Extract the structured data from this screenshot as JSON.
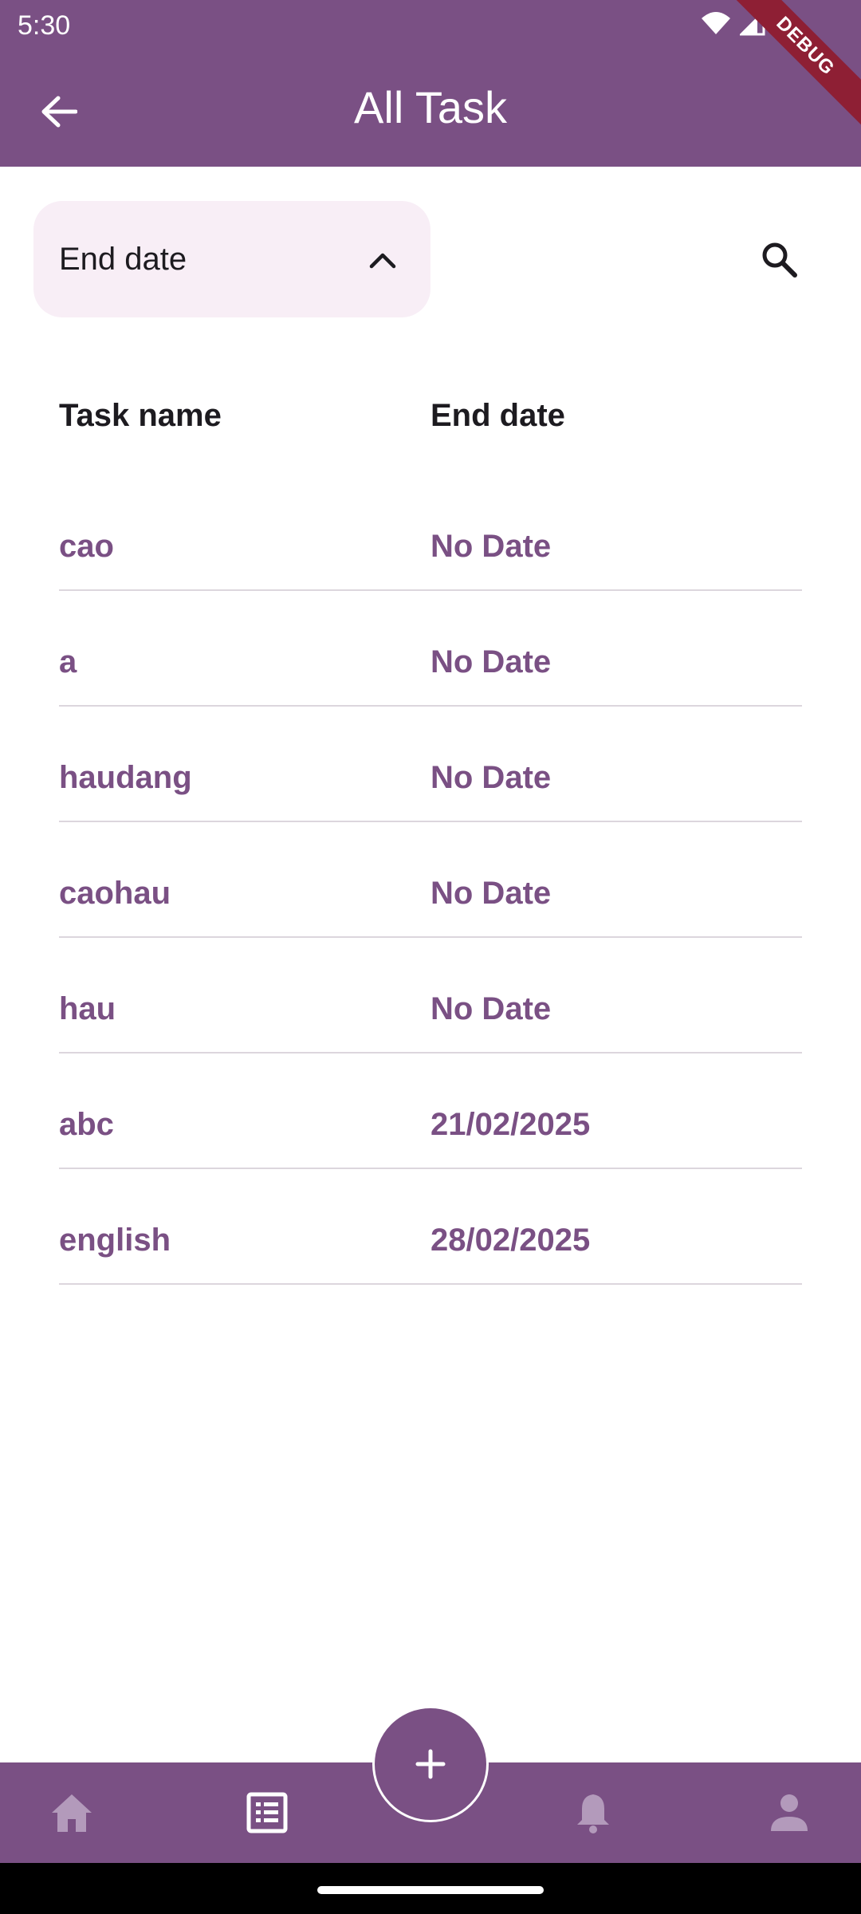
{
  "status_bar": {
    "time": "5:30",
    "debug_label": "DEBUG"
  },
  "header": {
    "title": "All Task",
    "back_icon": "arrow-left-icon"
  },
  "sort": {
    "selected": "End date",
    "icon": "chevron-up-icon"
  },
  "search": {
    "icon": "search-icon"
  },
  "table": {
    "columns": [
      "Task name",
      "End date"
    ],
    "rows": [
      {
        "name": "cao",
        "end_date": "No Date"
      },
      {
        "name": "a",
        "end_date": "No Date"
      },
      {
        "name": "haudang",
        "end_date": "No Date"
      },
      {
        "name": "caohau",
        "end_date": "No Date"
      },
      {
        "name": "hau",
        "end_date": "No Date"
      },
      {
        "name": "abc",
        "end_date": "21/02/2025"
      },
      {
        "name": "english",
        "end_date": "28/02/2025"
      }
    ]
  },
  "bottom_nav": {
    "items": [
      {
        "icon": "home-icon",
        "active": false
      },
      {
        "icon": "task-list-icon",
        "active": true
      },
      {
        "icon": "bell-icon",
        "active": false
      },
      {
        "icon": "person-icon",
        "active": false
      }
    ],
    "fab_icon": "plus-icon"
  },
  "colors": {
    "primary": "#7a5084",
    "dropdown_bg": "#f8eef6",
    "text_dark": "#1d1b20",
    "ribbon": "#8e1f34"
  }
}
